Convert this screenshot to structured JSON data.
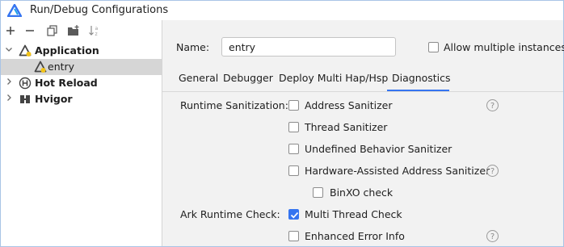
{
  "window": {
    "title": "Run/Debug Configurations"
  },
  "toolbar": {
    "add": "+",
    "remove": "−"
  },
  "tree": {
    "application": {
      "label": "Application",
      "icon": "triangle-app-icon",
      "expanded": true
    },
    "entry": {
      "label": "entry",
      "icon": "harmony-module-icon",
      "selected": true
    },
    "hot_reload": {
      "label": "Hot Reload",
      "icon": "hot-reload-h-icon"
    },
    "hvigor": {
      "label": "Hvigor",
      "icon": "hvigor-icon"
    }
  },
  "form": {
    "name_label": "Name:",
    "name_value": "entry",
    "allow_multiple": {
      "label": "Allow multiple instances",
      "checked": false
    }
  },
  "tabs": [
    {
      "label": "General"
    },
    {
      "label": "Debugger"
    },
    {
      "label": "Deploy Multi Hap/Hsp"
    },
    {
      "label": "Diagnostics",
      "active": true
    }
  ],
  "diagnostics": {
    "runtime_sanitization_label": "Runtime Sanitization:",
    "address_sanitizer": {
      "label": "Address Sanitizer",
      "checked": false
    },
    "thread_sanitizer": {
      "label": "Thread Sanitizer",
      "checked": false
    },
    "undefined_behavior_sanitizer": {
      "label": "Undefined Behavior Sanitizer",
      "checked": false
    },
    "hwasan": {
      "label": "Hardware-Assisted Address Sanitizer",
      "checked": false
    },
    "binxo_check": {
      "label": "BinXO check",
      "checked": false
    },
    "ark_runtime_check_label": "Ark Runtime Check:",
    "multi_thread_check": {
      "label": "Multi Thread Check",
      "checked": true
    },
    "enhanced_error_info": {
      "label": "Enhanced Error Info",
      "checked": false
    },
    "help_glyph": "?"
  },
  "colors": {
    "accent": "#3574f0",
    "selection": "#d6d6d6",
    "panel": "#f2f2f2"
  }
}
